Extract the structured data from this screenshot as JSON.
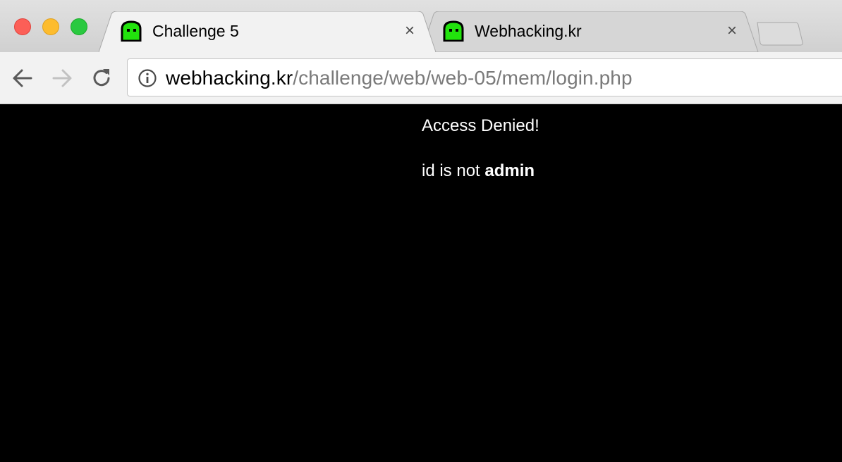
{
  "browser": {
    "tabs": [
      {
        "title": "Challenge 5",
        "favicon": "green-ghost-icon",
        "active": true
      },
      {
        "title": "Webhacking.kr",
        "favicon": "green-ghost-icon",
        "active": false
      }
    ],
    "tab_close_symbol": "×",
    "address_bar": {
      "host": "webhacking.kr",
      "path": "/challenge/web/web-05/mem/login.php"
    }
  },
  "page": {
    "line1": "Access Denied!",
    "line2_prefix": "id is not ",
    "line2_bold": "admin"
  },
  "colors": {
    "page_background": "#000000",
    "page_text": "#ffffff",
    "favicon_green": "#22e30d"
  }
}
